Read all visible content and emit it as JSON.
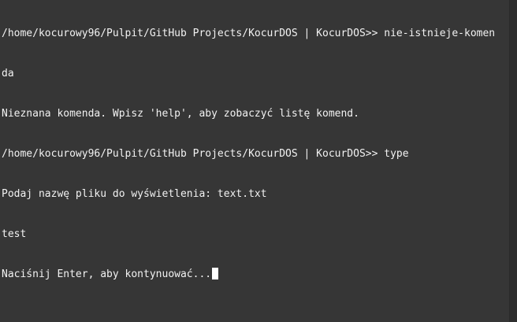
{
  "terminal": {
    "lines": [
      "/home/kocurowy96/Pulpit/GitHub Projects/KocurDOS | KocurDOS>> nie-istnieje-komen",
      "da",
      "Nieznana komenda. Wpisz 'help', aby zobaczyć listę komend.",
      "/home/kocurowy96/Pulpit/GitHub Projects/KocurDOS | KocurDOS>> type",
      "Podaj nazwę pliku do wyświetlenia: text.txt",
      "test",
      "Naciśnij Enter, aby kontynuować..."
    ]
  },
  "colors": {
    "background": "#363636",
    "foreground": "#f2f2f2",
    "cursor": "#ffffff"
  }
}
